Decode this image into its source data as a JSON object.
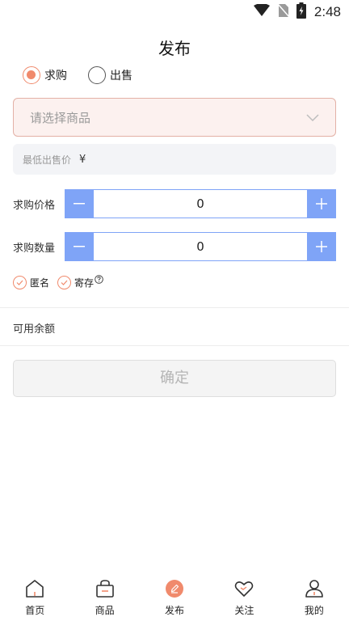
{
  "status_bar": {
    "time": "2:48"
  },
  "page": {
    "title": "发布"
  },
  "trade_type": {
    "options": [
      {
        "label": "求购",
        "selected": true
      },
      {
        "label": "出售",
        "selected": false
      }
    ]
  },
  "product_select": {
    "placeholder": "请选择商品"
  },
  "min_sale_price": {
    "label": "最低出售价",
    "currency": "¥"
  },
  "bid_price": {
    "label": "求购价格",
    "value": "0",
    "minus": "−",
    "plus": "+"
  },
  "bid_quantity": {
    "label": "求购数量",
    "value": "0",
    "minus": "−",
    "plus": "+"
  },
  "options": {
    "anonymous_label": "匿名",
    "consign_label": "寄存"
  },
  "balance": {
    "label": "可用余额"
  },
  "confirm": {
    "label": "确定"
  },
  "tab_bar": {
    "items": [
      {
        "label": "首页",
        "icon": "home-icon"
      },
      {
        "label": "商品",
        "icon": "bag-icon"
      },
      {
        "label": "发布",
        "icon": "publish-icon",
        "active": true
      },
      {
        "label": "关注",
        "icon": "heart-icon"
      },
      {
        "label": "我的",
        "icon": "person-icon"
      }
    ]
  },
  "colors": {
    "accent": "#f08a6c",
    "stepper": "#7fa4f7"
  }
}
